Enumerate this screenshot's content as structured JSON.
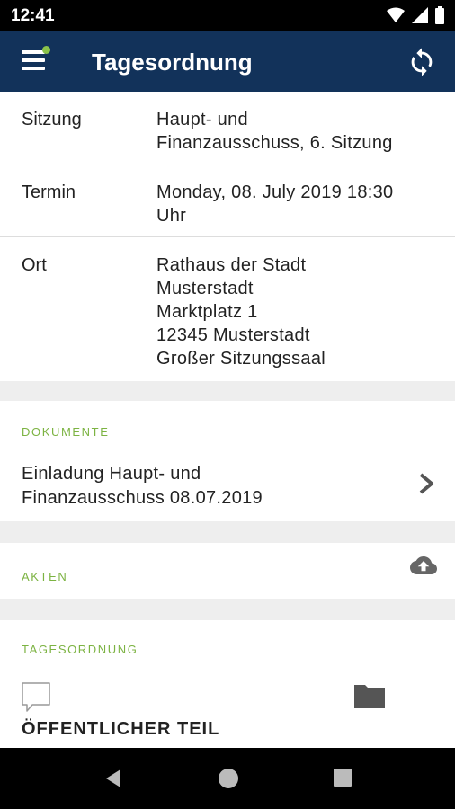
{
  "status_bar": {
    "time": "12:41"
  },
  "app_bar": {
    "title": "Tagesordnung"
  },
  "meeting": {
    "sitzung": {
      "label": "Sitzung",
      "lines": [
        "Haupt- und",
        "Finanzausschuss, 6. Sitzung"
      ]
    },
    "termin": {
      "label": "Termin",
      "lines": [
        "Monday, 08. July 2019 18:30",
        "Uhr"
      ]
    },
    "ort": {
      "label": "Ort",
      "lines": [
        "Rathaus der Stadt",
        "Musterstadt",
        "Marktplatz 1",
        "12345 Musterstadt",
        "Großer Sitzungssaal"
      ]
    }
  },
  "dokumente": {
    "heading": "DOKUMENTE",
    "items": [
      {
        "lines": [
          "Einladung Haupt- und",
          "Finanzausschuss 08.07.2019"
        ]
      }
    ]
  },
  "akten": {
    "heading": "AKTEN"
  },
  "tagesordnung": {
    "heading": "TAGESORDNUNG",
    "first_section": "ÖFFENTLICHER TEIL"
  },
  "colors": {
    "app_bar": "#12325a",
    "accent_green": "#7cb342",
    "background": "#eeeeee"
  },
  "icons": [
    "menu-icon",
    "refresh-icon",
    "chevron-right-icon",
    "cloud-upload-icon",
    "comment-icon",
    "folder-icon",
    "back-icon",
    "home-icon",
    "recents-icon"
  ]
}
